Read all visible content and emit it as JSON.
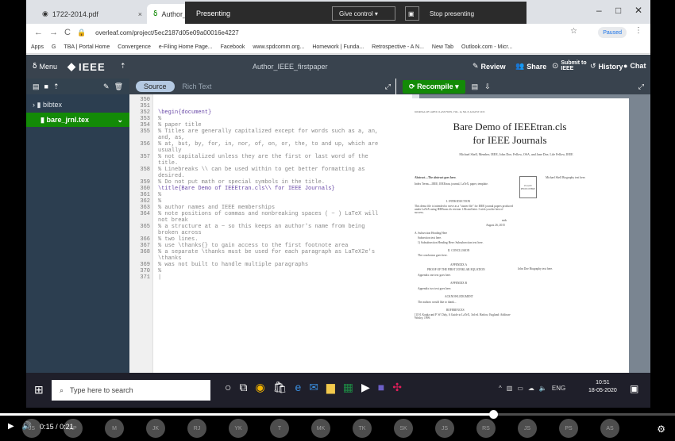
{
  "browser": {
    "tabs": [
      {
        "label": "1722-2014.pdf"
      },
      {
        "label": "Author_II"
      }
    ],
    "presenting_banner": {
      "status": "Presenting",
      "give_control": "Give control",
      "stop": "Stop presenting"
    },
    "url": "overleaf.com/project/5ec2187d05e09a00016e4227",
    "profile_status": "Paused",
    "bookmarks": [
      "Apps",
      "G",
      "TBA | Portal Home",
      "Convergence",
      "e-Filing Home Page...",
      "Facebook",
      "www.spdcomm.org...",
      "Homework | Funda...",
      "Retrospective - A N...",
      "New Tab",
      "Outlook.com - Micr..."
    ]
  },
  "overleaf": {
    "menu": "Menu",
    "brand": "IEEE",
    "project_title": "Author_IEEE_firstpaper",
    "review": "Review",
    "share": "Share",
    "submit": "Submit to IEEE",
    "history": "History",
    "chat": "Chat",
    "source_tab": "Source",
    "richtext_tab": "Rich Text",
    "recompile": "Recompile"
  },
  "filetree": {
    "folder": "bibtex",
    "file": "bare_jrnl.tex"
  },
  "editor": {
    "lines": [
      {
        "n": "350",
        "t": "",
        "kind": "comm"
      },
      {
        "n": "351",
        "t": "",
        "kind": "comm"
      },
      {
        "n": "352",
        "t": "\\begin{document}",
        "kind": "cmd"
      },
      {
        "n": "353",
        "t": "%",
        "kind": "comm"
      },
      {
        "n": "354",
        "t": "% paper title",
        "kind": "comm"
      },
      {
        "n": "355",
        "t": "% Titles are generally capitalized except for words such as a, an, and, as,",
        "kind": "comm"
      },
      {
        "n": "356",
        "t": "% at, but, by, for, in, nor, of, on, or, the, to and up, which are usually",
        "kind": "comm"
      },
      {
        "n": "357",
        "t": "% not capitalized unless they are the first or last word of the title.",
        "kind": "comm"
      },
      {
        "n": "358",
        "t": "% Linebreaks \\\\ can be used within to get better formatting as desired.",
        "kind": "comm"
      },
      {
        "n": "359",
        "t": "% Do not put math or special symbols in the title.",
        "kind": "comm"
      },
      {
        "n": "360",
        "t": "\\title{Bare Demo of IEEEtran.cls\\\\ for IEEE Journals}",
        "kind": "cmd"
      },
      {
        "n": "361",
        "t": "%",
        "kind": "comm"
      },
      {
        "n": "362",
        "t": "%",
        "kind": "comm"
      },
      {
        "n": "363",
        "t": "% author names and IEEE memberships",
        "kind": "comm"
      },
      {
        "n": "364",
        "t": "% note positions of commas and nonbreaking spaces ( ~ ) LaTeX will not break",
        "kind": "comm"
      },
      {
        "n": "365",
        "t": "% a structure at a ~ so this keeps an author's name from being broken across",
        "kind": "comm"
      },
      {
        "n": "366",
        "t": "% two lines.",
        "kind": "comm"
      },
      {
        "n": "367",
        "t": "% use \\thanks{} to gain access to the first footnote area",
        "kind": "comm"
      },
      {
        "n": "368",
        "t": "% a separate \\thanks must be used for each paragraph as LaTeX2e's \\thanks",
        "kind": "comm"
      },
      {
        "n": "369",
        "t": "% was not built to handle multiple paragraphs",
        "kind": "comm"
      },
      {
        "n": "370",
        "t": "%",
        "kind": "comm"
      },
      {
        "n": "371",
        "t": "|",
        "kind": "comm"
      }
    ]
  },
  "pdf": {
    "header": "JOURNAL OF LATEX CLASS FILES, VOL. 14, NO. 8, AUGUST 2015",
    "title_line1": "Bare Demo of IEEEtran.cls",
    "title_line2": "for IEEE Journals",
    "authors": "Michael Shell, Member, IEEE, John Doe, Fellow, OSA, and Jane Doe, Life Fellow, IEEE",
    "abstract": "Abstract—The abstract goes here.",
    "index_terms": "Index Terms—IEEE, IEEEtran, journal, LaTeX, paper, template.",
    "photo": "PLACE PHOTO HERE",
    "bio": "Michael Shell Biography text here.",
    "intro_heading": "I. INTRODUCTION",
    "intro_text": "This demo file is intended to serve as a \"starter file\" for IEEE journal papers produced under LaTeX using IEEEtran.cls version 1.8b and later. I wish you the best of success.",
    "signoff": "mds",
    "date": "August 26, 2015",
    "subsection_a": "A. Subsection Heading Here",
    "subsection_text": "Subsection text here.",
    "subsubsection": "1) Subsubsection Heading Here: Subsubsection text here.",
    "conclusion_heading": "II. CONCLUSION",
    "conclusion_text": "The conclusion goes here.",
    "appendix_a_heading": "APPENDIX A",
    "appendix_a_title": "PROOF OF THE FIRST ZONKLAR EQUATION",
    "appendix_a_text": "Appendix one text goes here.",
    "bio2": "John Doe Biography text here.",
    "appendix_b_heading": "APPENDIX B",
    "appendix_b_text": "Appendix two text goes here.",
    "ack_heading": "ACKNOWLEDGMENT",
    "ack_text": "The authors would like to thank...",
    "refs_heading": "REFERENCES",
    "ref1": "[1] H. Kopka and P. W. Daly, A Guide to LaTeX, 3rd ed. Harlow, England: Addison-Wesley, 1999."
  },
  "taskbar": {
    "search_placeholder": "Type here to search",
    "lang": "ENG",
    "time": "10:51",
    "date": "18-05-2020"
  },
  "player": {
    "time": "0:15 / 0:21",
    "progress_percent": 73,
    "participants": [
      "JS",
      "AP",
      "M",
      "JK",
      "RJ",
      "YK",
      "T",
      "MK",
      "TK",
      "SK",
      "JS",
      "RS",
      "JS",
      "PS",
      "AS"
    ]
  }
}
